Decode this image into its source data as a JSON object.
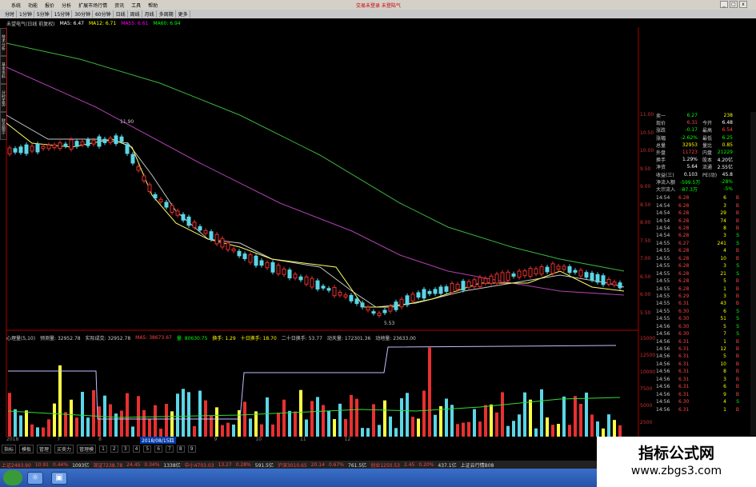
{
  "window": {
    "title": "交易未登录 未登陆气",
    "menu": [
      "系统",
      "功能",
      "报价",
      "分析",
      "扩展市场行情",
      "资讯",
      "工具",
      "帮助"
    ],
    "controls": [
      "_",
      "□",
      "x"
    ]
  },
  "toolbar": {
    "periods": [
      "分时",
      "1分钟",
      "5分钟",
      "15分钟",
      "30分钟",
      "60分钟",
      "日线",
      "周线",
      "月线",
      "多周期",
      "更多"
    ]
  },
  "left_tabs": [
    "技术分析",
    "基本资料",
    "分时走势",
    "财务图示"
  ],
  "ma_legend": {
    "name": "未望电气(日线 前复权)",
    "items": [
      {
        "text": "MA5: 6.47",
        "color": "#ffffff"
      },
      {
        "text": "MA12: 6.71",
        "color": "#ffff00"
      },
      {
        "text": "MA55: 6.61",
        "color": "#ff00ff"
      },
      {
        "text": "MA60: 6.94",
        "color": "#00ff00"
      }
    ]
  },
  "vol_legend": [
    {
      "text": "心理量(5,10)",
      "color": "#ccc"
    },
    {
      "text": "预测量: 32952.78",
      "color": "#ccc"
    },
    {
      "text": "实际成交: 32952.78",
      "color": "#ccc"
    },
    {
      "text": "MA5: 38673.67",
      "color": "#ff4444"
    },
    {
      "text": "量: 80630.75",
      "color": "#00ff00"
    },
    {
      "text": "换手: 1.29",
      "color": "#ffff00"
    },
    {
      "text": "十日换手: 18.70",
      "color": "#ffff00"
    },
    {
      "text": "二十日换手: 53.77",
      "color": "#ccc"
    },
    {
      "text": "动天量: 172301.36",
      "color": "#ccc"
    },
    {
      "text": "动地量: 23633.00",
      "color": "#ccc"
    }
  ],
  "price_axis": [
    "11.00",
    "10.50",
    "10.00",
    "9.50",
    "9.00",
    "8.50",
    "8.00",
    "7.50",
    "7.00",
    "6.50",
    "6.00",
    "5.50"
  ],
  "vol_axis": [
    "15000",
    "12500",
    "10000",
    "7500",
    "5000",
    "2500"
  ],
  "annotations": {
    "high": "11.90",
    "low": "5.53"
  },
  "date_axis": {
    "items": [
      "2018",
      "7",
      "8",
      "2018/08/15四",
      "9",
      "10",
      "11",
      "12"
    ],
    "highlight_index": 3
  },
  "page_tabs": [
    "指标",
    "模板",
    "管理",
    "买卖力",
    "管理模",
    "1",
    "2",
    "3",
    "4",
    "5",
    "6",
    "7",
    "8",
    "9"
  ],
  "ticker": [
    {
      "text": "上证2493.90",
      "color": "#f44"
    },
    {
      "text": "10.91",
      "color": "#f44"
    },
    {
      "text": "0.44%",
      "color": "#f44"
    },
    {
      "text": "1093亿",
      "color": "#ddd"
    },
    {
      "text": "深证7238.78",
      "color": "#f44"
    },
    {
      "text": "24.45",
      "color": "#f44"
    },
    {
      "text": "0.34%",
      "color": "#f44"
    },
    {
      "text": "1338亿",
      "color": "#ddd"
    },
    {
      "text": "中小4703.03",
      "color": "#f44"
    },
    {
      "text": "13.27",
      "color": "#f44"
    },
    {
      "text": "0.28%",
      "color": "#f44"
    },
    {
      "text": "591.5亿",
      "color": "#ddd"
    },
    {
      "text": "沪深3010.65",
      "color": "#f44"
    },
    {
      "text": "20.14",
      "color": "#f44"
    },
    {
      "text": "0.67%",
      "color": "#f44"
    },
    {
      "text": "761.5亿",
      "color": "#ddd"
    },
    {
      "text": "创业1250.53",
      "color": "#f44"
    },
    {
      "text": "2.45",
      "color": "#f44"
    },
    {
      "text": "0.20%",
      "color": "#f44"
    },
    {
      "text": "437.1亿",
      "color": "#ddd"
    },
    {
      "text": "上证云行情B08",
      "color": "#ddd"
    }
  ],
  "quote": [
    {
      "k": "卖一",
      "v": "6.27",
      "vc": "#0f0",
      "k2": "",
      "v2": "238",
      "v2c": "#ff0"
    },
    {
      "k": "现价",
      "v": "6.31",
      "vc": "#f44",
      "k2": "今开",
      "v2": "6.48",
      "v2c": "#fff"
    },
    {
      "k": "涨跌",
      "v": "-0.17",
      "vc": "#0f0",
      "k2": "最高",
      "v2": "6.54",
      "v2c": "#f44"
    },
    {
      "k": "涨幅",
      "v": "-2.62%",
      "vc": "#0f0",
      "k2": "最低",
      "v2": "6.25",
      "v2c": "#0f0"
    },
    {
      "k": "总量",
      "v": "32953",
      "vc": "#ff0",
      "k2": "量比",
      "v2": "0.85",
      "v2c": "#ff0"
    },
    {
      "k": "外盘",
      "v": "11723",
      "vc": "#f44",
      "k2": "内盘",
      "v2": "21229",
      "v2c": "#0f0"
    },
    {
      "k": "换手",
      "v": "1.29%",
      "vc": "#fff",
      "k2": "股本",
      "v2": "4.20亿",
      "v2c": "#fff"
    },
    {
      "k": "净资",
      "v": "5.64",
      "vc": "#fff",
      "k2": "流通",
      "v2": "2.55亿",
      "v2c": "#fff"
    },
    {
      "k": "收益(三)",
      "v": "0.103",
      "vc": "#fff",
      "k2": "PE(动)",
      "v2": "45.8",
      "v2c": "#fff"
    },
    {
      "k": "净流入额",
      "v": "-599.5万",
      "vc": "#0f0",
      "k2": "",
      "v2": "-28%",
      "v2c": "#0f0"
    },
    {
      "k": "大宗流入",
      "v": "-87.3万",
      "vc": "#0f0",
      "k2": "",
      "v2": "-5%",
      "v2c": "#0f0"
    }
  ],
  "trades": [
    {
      "t": "14:54",
      "p": "6.28",
      "q": "6",
      "bs": "B",
      "c": "#f44"
    },
    {
      "t": "14:54",
      "p": "6.28",
      "q": "3",
      "bs": "B",
      "c": "#f44"
    },
    {
      "t": "14:54",
      "p": "6.28",
      "q": "29",
      "bs": "B",
      "c": "#f44"
    },
    {
      "t": "14:54",
      "p": "6.28",
      "q": "74",
      "bs": "B",
      "c": "#f44"
    },
    {
      "t": "14:54",
      "p": "6.28",
      "q": "8",
      "bs": "B",
      "c": "#f44"
    },
    {
      "t": "14:54",
      "p": "6.28",
      "q": "3",
      "bs": "S",
      "c": "#0f0"
    },
    {
      "t": "14:55",
      "p": "6.27",
      "q": "241",
      "bs": "S",
      "c": "#0f0"
    },
    {
      "t": "14:55",
      "p": "6.28",
      "q": "4",
      "bs": "B",
      "c": "#f44"
    },
    {
      "t": "14:55",
      "p": "6.28",
      "q": "10",
      "bs": "B",
      "c": "#f44"
    },
    {
      "t": "14:55",
      "p": "6.28",
      "q": "3",
      "bs": "S",
      "c": "#0f0"
    },
    {
      "t": "14:55",
      "p": "6.28",
      "q": "21",
      "bs": "S",
      "c": "#0f0"
    },
    {
      "t": "14:55",
      "p": "6.28",
      "q": "5",
      "bs": "B",
      "c": "#f44"
    },
    {
      "t": "14:55",
      "p": "6.28",
      "q": "1",
      "bs": "B",
      "c": "#f44"
    },
    {
      "t": "14:55",
      "p": "6.29",
      "q": "3",
      "bs": "B",
      "c": "#f44"
    },
    {
      "t": "14:55",
      "p": "6.31",
      "q": "43",
      "bs": "B",
      "c": "#f44"
    },
    {
      "t": "14:55",
      "p": "6.30",
      "q": "6",
      "bs": "S",
      "c": "#0f0"
    },
    {
      "t": "14:55",
      "p": "6.30",
      "q": "51",
      "bs": "S",
      "c": "#0f0"
    },
    {
      "t": "14:56",
      "p": "6.30",
      "q": "5",
      "bs": "S",
      "c": "#0f0"
    },
    {
      "t": "14:56",
      "p": "6.30",
      "q": "7",
      "bs": "S",
      "c": "#0f0"
    },
    {
      "t": "14:56",
      "p": "6.31",
      "q": "1",
      "bs": "B",
      "c": "#f44"
    },
    {
      "t": "14:56",
      "p": "6.31",
      "q": "12",
      "bs": "B",
      "c": "#f44"
    },
    {
      "t": "14:56",
      "p": "6.31",
      "q": "5",
      "bs": "B",
      "c": "#f44"
    },
    {
      "t": "14:56",
      "p": "6.31",
      "q": "10",
      "bs": "B",
      "c": "#f44"
    },
    {
      "t": "14:56",
      "p": "6.31",
      "q": "8",
      "bs": "B",
      "c": "#f44"
    },
    {
      "t": "14:56",
      "p": "6.31",
      "q": "3",
      "bs": "B",
      "c": "#f44"
    },
    {
      "t": "14:56",
      "p": "6.31",
      "q": "6",
      "bs": "B",
      "c": "#f44"
    },
    {
      "t": "14:56",
      "p": "6.31",
      "q": "9",
      "bs": "B",
      "c": "#f44"
    },
    {
      "t": "14:56",
      "p": "6.30",
      "q": "4",
      "bs": "S",
      "c": "#0f0"
    },
    {
      "t": "14:56",
      "p": "6.31",
      "q": "1",
      "bs": "B",
      "c": "#f44"
    }
  ],
  "watermark": {
    "title": "指标公式网",
    "url": "www.zbgs3.com"
  }
}
